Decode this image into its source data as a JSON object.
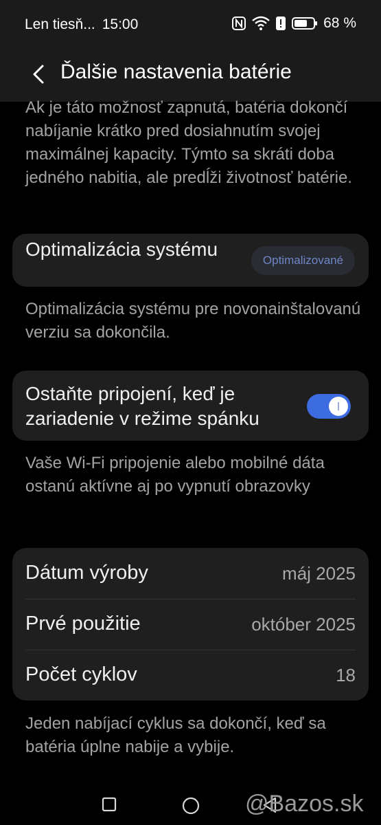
{
  "status_bar": {
    "carrier": "Len tiesň...",
    "time": "15:00",
    "battery_percent": "68 %",
    "battery_level": 0.68,
    "icons": [
      "nfc-icon",
      "wifi-icon",
      "alert-icon",
      "battery-icon"
    ]
  },
  "header": {
    "title": "Ďalšie nastavenia batérie",
    "back_icon": "chevron-left-icon"
  },
  "top_description": "Ak je táto možnosť zapnutá, batéria dokončí nabíjanie krátko pred dosiahnutím svojej maximálnej kapacity. Týmto sa skráti doba jedného nabitia, ale predĺži životnosť batérie.",
  "optimization": {
    "label": "Optimalizácia systému",
    "badge": "Optimalizované",
    "description": "Optimalizácia systému pre novonainštalovanú verziu sa dokončila."
  },
  "stay_connected": {
    "label": "Ostaňte pripojení, keď je zariadenie v režime spánku",
    "enabled": true,
    "description": "Vaše Wi-Fi pripojenie alebo mobilné dáta ostanú aktívne aj po vypnutí obrazovky"
  },
  "info": {
    "rows": [
      {
        "key": "Dátum výroby",
        "value": "máj 2025"
      },
      {
        "key": "Prvé použitie",
        "value": "október 2025"
      },
      {
        "key": "Počet cyklov",
        "value": "18"
      }
    ],
    "description": "Jeden nabíjací cyklus sa dokončí, keď sa batéria úplne nabije a vybije."
  },
  "nav": {
    "icons": [
      "recents-square-icon",
      "home-circle-icon",
      "back-triangle-icon"
    ]
  },
  "watermark": "@Bazos.sk",
  "colors": {
    "accent": "#3d6be0",
    "card": "#1f1f1f",
    "background": "#000000"
  }
}
